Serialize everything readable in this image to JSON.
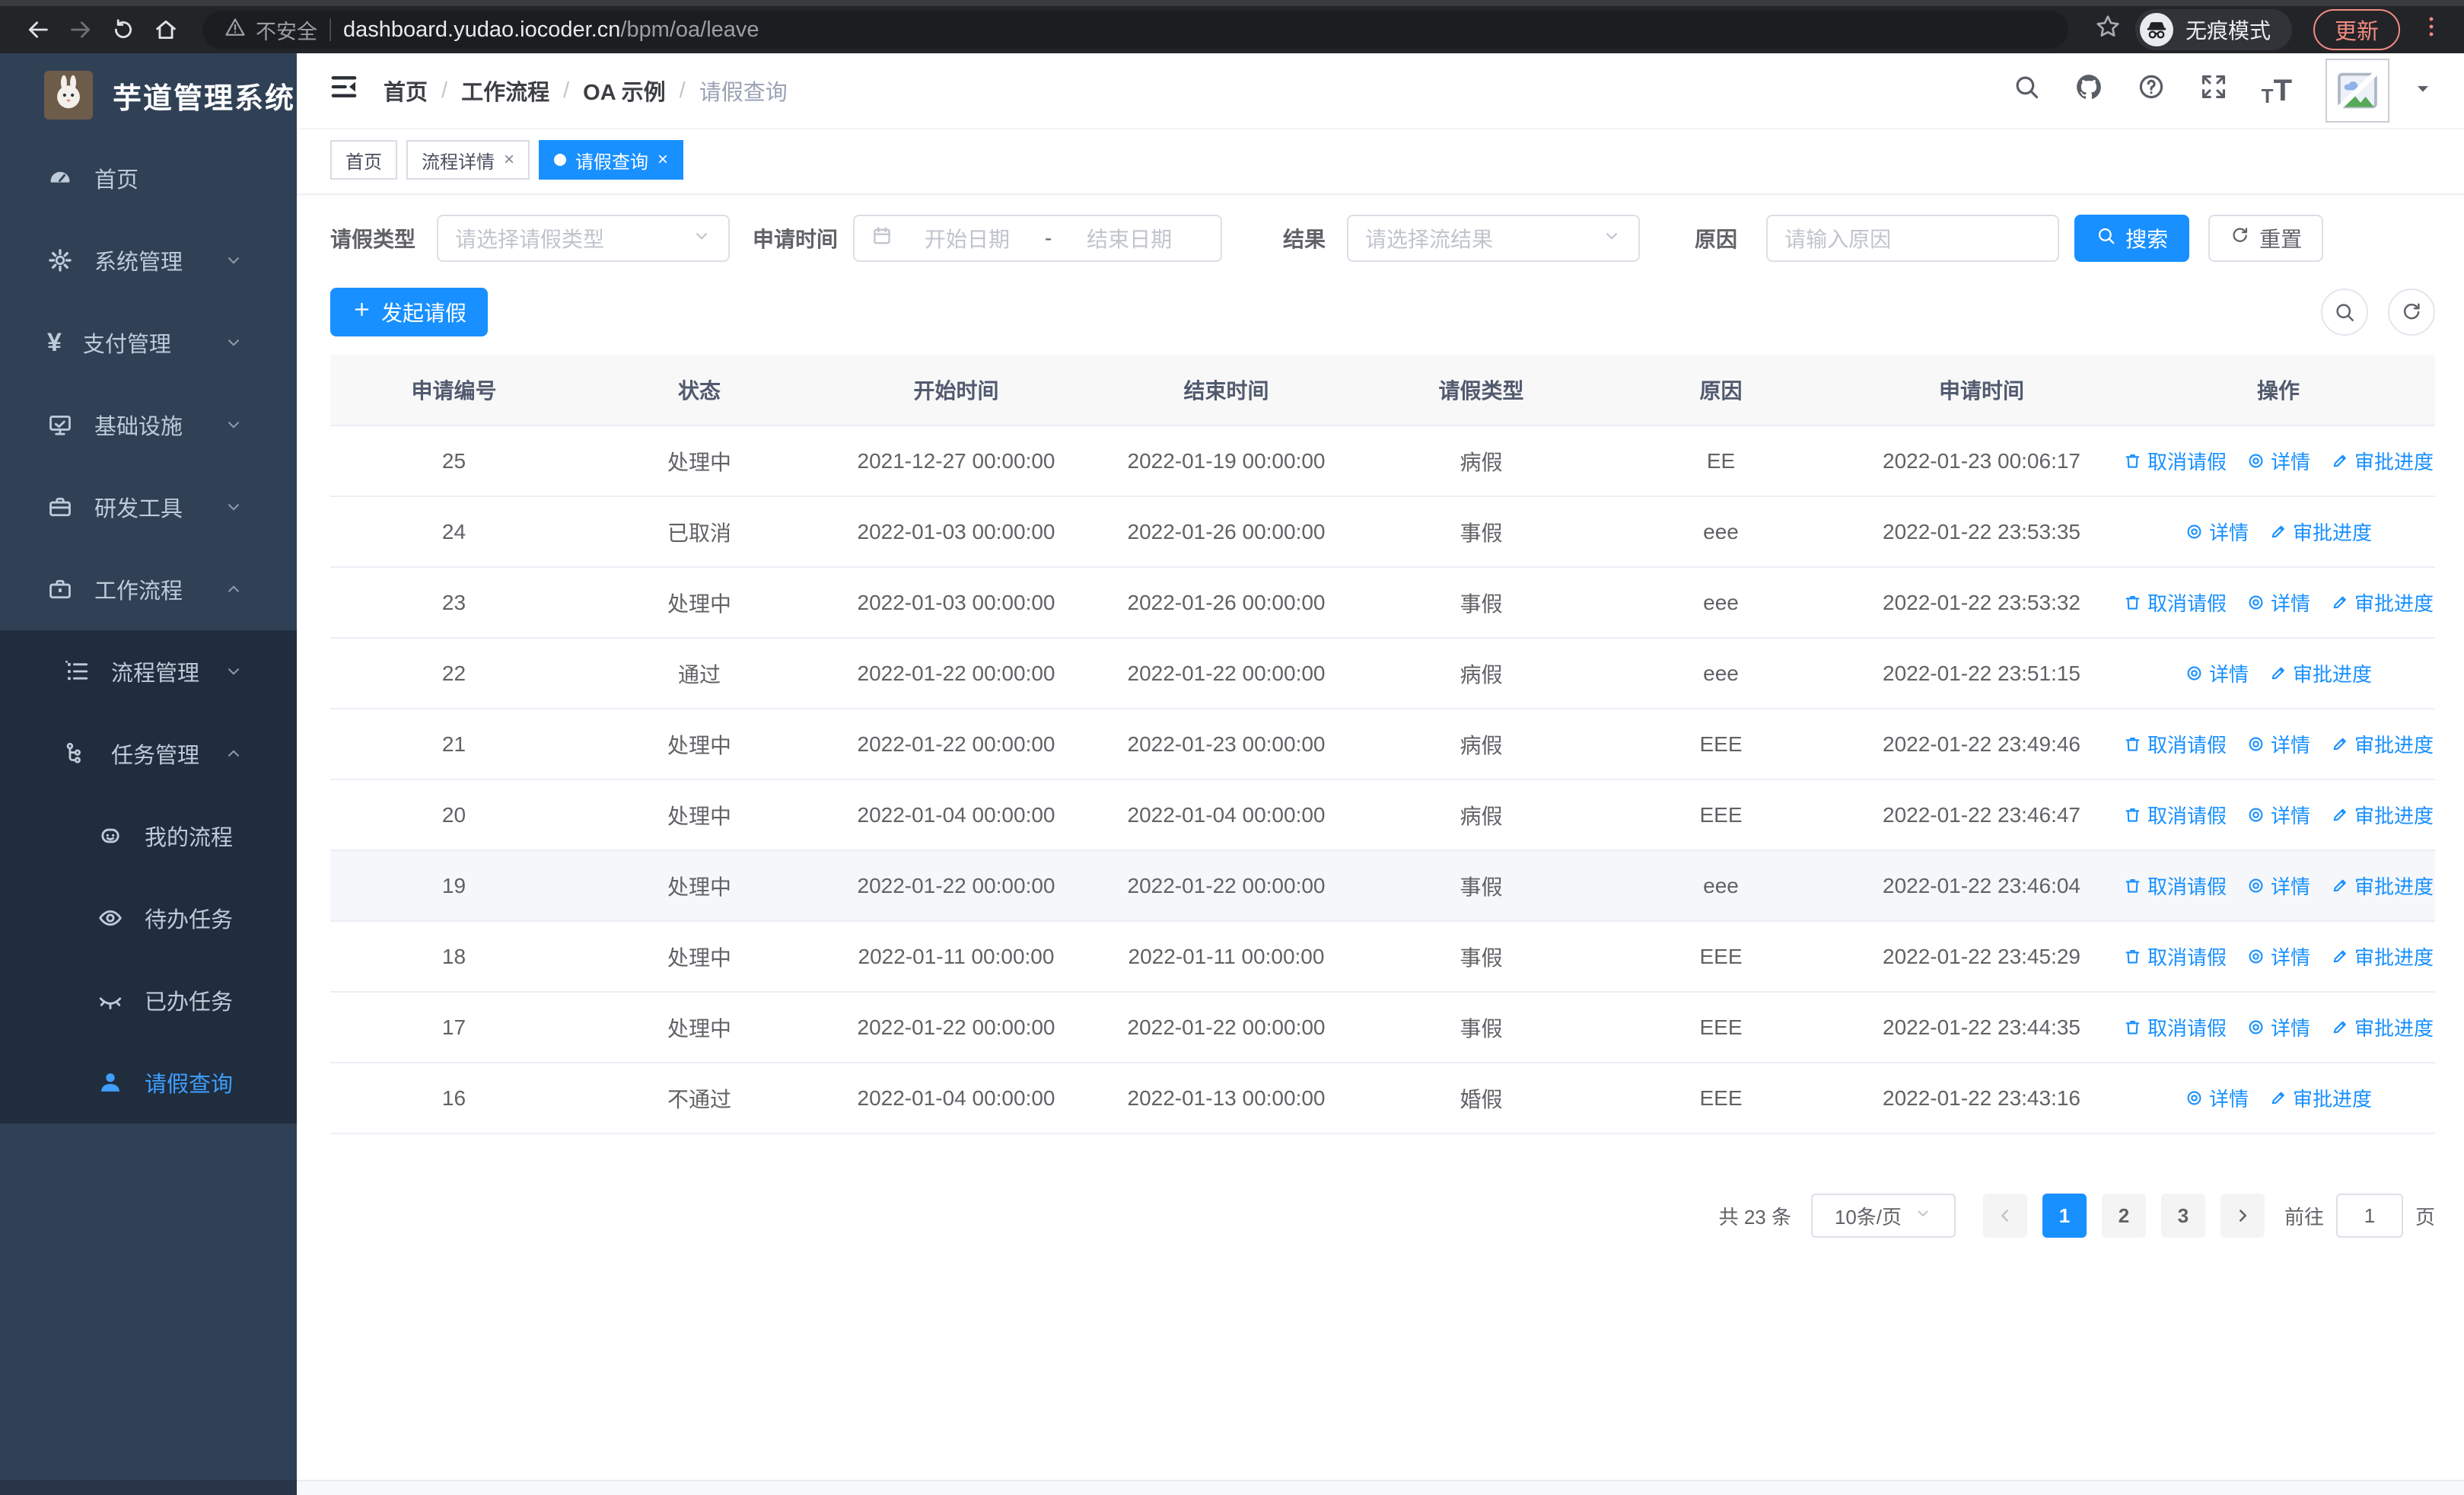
{
  "browser": {
    "security_label": "不安全",
    "url_host": "dashboard.yudao.iocoder.cn",
    "url_path": "/bpm/oa/leave",
    "incognito_label": "无痕模式",
    "update_label": "更新"
  },
  "sidebar": {
    "title": "芋道管理系统",
    "items": [
      {
        "name": "home",
        "label": "首页",
        "icon": "dashboard",
        "level": 1
      },
      {
        "name": "system-management",
        "label": "系统管理",
        "icon": "gear",
        "level": 1,
        "chevron": "down"
      },
      {
        "name": "payment-management",
        "label": "支付管理",
        "icon": "yen",
        "level": 1,
        "chevron": "down"
      },
      {
        "name": "infrastructure",
        "label": "基础设施",
        "icon": "monitor",
        "level": 1,
        "chevron": "down"
      },
      {
        "name": "dev-tools",
        "label": "研发工具",
        "icon": "toolbox",
        "level": 1,
        "chevron": "down"
      },
      {
        "name": "workflow",
        "label": "工作流程",
        "icon": "briefcase",
        "level": 1,
        "chevron": "up"
      },
      {
        "name": "process-management",
        "label": "流程管理",
        "icon": "list",
        "level": 2,
        "chevron": "down",
        "submenu": true
      },
      {
        "name": "task-management",
        "label": "任务管理",
        "icon": "tree",
        "level": 2,
        "chevron": "up",
        "submenu": true
      },
      {
        "name": "my-process",
        "label": "我的流程",
        "icon": "robot",
        "level": 3,
        "submenu": true
      },
      {
        "name": "todo-tasks",
        "label": "待办任务",
        "icon": "eye",
        "level": 3,
        "submenu": true
      },
      {
        "name": "done-tasks",
        "label": "已办任务",
        "icon": "eye-closed",
        "level": 3,
        "submenu": true
      },
      {
        "name": "leave-query",
        "label": "请假查询",
        "icon": "user",
        "level": 3,
        "submenu": true,
        "active": true
      }
    ]
  },
  "header": {
    "breadcrumb": [
      "首页",
      "工作流程",
      "OA 示例",
      "请假查询"
    ]
  },
  "tabs": [
    {
      "name": "home",
      "label": "首页"
    },
    {
      "name": "process-detail",
      "label": "流程详情",
      "closable": true
    },
    {
      "name": "leave-query",
      "label": "请假查询",
      "closable": true,
      "active": true
    }
  ],
  "filters": {
    "type_label": "请假类型",
    "type_placeholder": "请选择请假类型",
    "time_label": "申请时间",
    "start_placeholder": "开始日期",
    "range_separator": "-",
    "end_placeholder": "结束日期",
    "result_label": "结果",
    "result_placeholder": "请选择流结果",
    "reason_label": "原因",
    "reason_placeholder": "请输入原因",
    "search_label": "搜索",
    "reset_label": "重置"
  },
  "toolbar": {
    "create_label": "发起请假"
  },
  "table": {
    "columns": [
      "申请编号",
      "状态",
      "开始时间",
      "结束时间",
      "请假类型",
      "原因",
      "申请时间",
      "操作"
    ],
    "action_labels": {
      "cancel": "取消请假",
      "detail": "详情",
      "progress": "审批进度"
    },
    "rows": [
      {
        "id": "25",
        "status": "处理中",
        "start": "2021-12-27 00:00:00",
        "end": "2022-01-19 00:00:00",
        "type": "病假",
        "reason": "EE",
        "apply_time": "2022-01-23 00:06:17",
        "actions": [
          "cancel",
          "detail",
          "progress"
        ]
      },
      {
        "id": "24",
        "status": "已取消",
        "start": "2022-01-03 00:00:00",
        "end": "2022-01-26 00:00:00",
        "type": "事假",
        "reason": "eee",
        "apply_time": "2022-01-22 23:53:35",
        "actions": [
          "detail",
          "progress"
        ]
      },
      {
        "id": "23",
        "status": "处理中",
        "start": "2022-01-03 00:00:00",
        "end": "2022-01-26 00:00:00",
        "type": "事假",
        "reason": "eee",
        "apply_time": "2022-01-22 23:53:32",
        "actions": [
          "cancel",
          "detail",
          "progress"
        ]
      },
      {
        "id": "22",
        "status": "通过",
        "start": "2022-01-22 00:00:00",
        "end": "2022-01-22 00:00:00",
        "type": "病假",
        "reason": "eee",
        "apply_time": "2022-01-22 23:51:15",
        "actions": [
          "detail",
          "progress"
        ]
      },
      {
        "id": "21",
        "status": "处理中",
        "start": "2022-01-22 00:00:00",
        "end": "2022-01-23 00:00:00",
        "type": "病假",
        "reason": "EEE",
        "apply_time": "2022-01-22 23:49:46",
        "actions": [
          "cancel",
          "detail",
          "progress"
        ]
      },
      {
        "id": "20",
        "status": "处理中",
        "start": "2022-01-04 00:00:00",
        "end": "2022-01-04 00:00:00",
        "type": "病假",
        "reason": "EEE",
        "apply_time": "2022-01-22 23:46:47",
        "actions": [
          "cancel",
          "detail",
          "progress"
        ]
      },
      {
        "id": "19",
        "status": "处理中",
        "start": "2022-01-22 00:00:00",
        "end": "2022-01-22 00:00:00",
        "type": "事假",
        "reason": "eee",
        "apply_time": "2022-01-22 23:46:04",
        "actions": [
          "cancel",
          "detail",
          "progress"
        ],
        "highlighted": true
      },
      {
        "id": "18",
        "status": "处理中",
        "start": "2022-01-11 00:00:00",
        "end": "2022-01-11 00:00:00",
        "type": "事假",
        "reason": "EEE",
        "apply_time": "2022-01-22 23:45:29",
        "actions": [
          "cancel",
          "detail",
          "progress"
        ]
      },
      {
        "id": "17",
        "status": "处理中",
        "start": "2022-01-22 00:00:00",
        "end": "2022-01-22 00:00:00",
        "type": "事假",
        "reason": "EEE",
        "apply_time": "2022-01-22 23:44:35",
        "actions": [
          "cancel",
          "detail",
          "progress"
        ]
      },
      {
        "id": "16",
        "status": "不通过",
        "start": "2022-01-04 00:00:00",
        "end": "2022-01-13 00:00:00",
        "type": "婚假",
        "reason": "EEE",
        "apply_time": "2022-01-22 23:43:16",
        "actions": [
          "detail",
          "progress"
        ]
      }
    ]
  },
  "pagination": {
    "total_label": "共 23 条",
    "page_size": "10条/页",
    "pages": [
      "1",
      "2",
      "3"
    ],
    "active_page": "1",
    "prev_disabled": true,
    "goto_label": "前往",
    "goto_value": "1",
    "page_suffix": "页"
  },
  "colors": {
    "primary": "#1890ff",
    "sidebar_bg": "#304156",
    "submenu_bg": "#1f2d3d",
    "menu_text": "#bfcbd9",
    "menu_active_text": "#409eff"
  }
}
